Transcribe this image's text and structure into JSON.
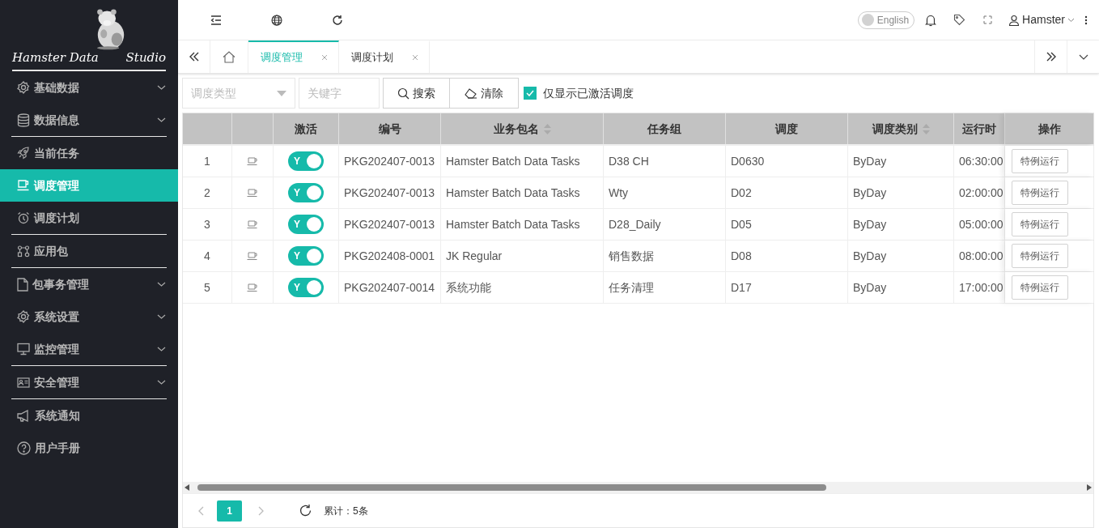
{
  "logo": {
    "line_1": "Hamster Data",
    "line_2": "Studio"
  },
  "sidebar": {
    "items": [
      {
        "label": "基础数据",
        "expandable": true,
        "selected": false,
        "divider_below": false
      },
      {
        "label": "数据信息",
        "expandable": true,
        "selected": false,
        "divider_below": true
      },
      {
        "label": "当前任务",
        "expandable": false,
        "selected": false,
        "divider_below": false
      },
      {
        "label": "调度管理",
        "expandable": false,
        "selected": true,
        "divider_below": false
      },
      {
        "label": "调度计划",
        "expandable": false,
        "selected": false,
        "divider_below": true
      },
      {
        "label": "应用包",
        "expandable": false,
        "selected": false,
        "divider_below": true
      },
      {
        "label": "包事务管理",
        "expandable": true,
        "selected": false,
        "divider_below": false
      },
      {
        "label": "系统设置",
        "expandable": true,
        "selected": false,
        "divider_below": false
      },
      {
        "label": "监控管理",
        "expandable": true,
        "selected": false,
        "divider_below": true
      },
      {
        "label": "安全管理",
        "expandable": true,
        "selected": false,
        "divider_below": true
      },
      {
        "label": "系统通知",
        "expandable": false,
        "selected": false,
        "divider_below": false
      },
      {
        "label": "用户手册",
        "expandable": false,
        "selected": false,
        "divider_below": false
      }
    ]
  },
  "topbar": {
    "language": {
      "label": "English",
      "on": false
    },
    "user": "Hamster"
  },
  "tabs": [
    {
      "label": "调度管理",
      "selected": true
    },
    {
      "label": "调度计划",
      "selected": false
    }
  ],
  "filters": {
    "type_placeholder": "调度类型",
    "keyword_placeholder": "关键字",
    "search_button": "搜索",
    "clear_button": "清除",
    "active_only": {
      "label": "仅显示已激活调度",
      "checked": true
    }
  },
  "table": {
    "columns": [
      {},
      {},
      {
        "label": "激活"
      },
      {
        "label": "编号"
      },
      {
        "label": "业务包名",
        "sortable": true
      },
      {
        "label": "任务组"
      },
      {
        "label": "调度"
      },
      {
        "label": "调度类别",
        "sortable": true
      },
      {
        "label": "运行时"
      },
      {
        "label": "操作"
      }
    ],
    "rows": [
      {
        "index": "1",
        "active": true,
        "active_label": "Y",
        "code": "PKG202407-0013",
        "package": "Hamster Batch Data Tasks",
        "group": "D38 CH",
        "schedule": "D0630",
        "category": "ByDay",
        "time": "06:30:00",
        "action": "特例运行"
      },
      {
        "index": "2",
        "active": true,
        "active_label": "Y",
        "code": "PKG202407-0013",
        "package": "Hamster Batch Data Tasks",
        "group": "Wty",
        "schedule": "D02",
        "category": "ByDay",
        "time": "02:00:00",
        "action": "特例运行"
      },
      {
        "index": "3",
        "active": true,
        "active_label": "Y",
        "code": "PKG202407-0013",
        "package": "Hamster Batch Data Tasks",
        "group": "D28_Daily",
        "schedule": "D05",
        "category": "ByDay",
        "time": "05:00:00",
        "action": "特例运行"
      },
      {
        "index": "4",
        "active": true,
        "active_label": "Y",
        "code": "PKG202408-0001",
        "package": "JK Regular",
        "group": "销售数据",
        "schedule": "D08",
        "category": "ByDay",
        "time": "08:00:00",
        "action": "特例运行"
      },
      {
        "index": "5",
        "active": true,
        "active_label": "Y",
        "code": "PKG202407-0014",
        "package": "系统功能",
        "group": "任务清理",
        "schedule": "D17",
        "category": "ByDay",
        "time": "17:00:00",
        "action": "特例运行"
      }
    ]
  },
  "pagination": {
    "pages": [
      {
        "label": "1",
        "selected": true
      }
    ],
    "total": "累计：5条"
  }
}
